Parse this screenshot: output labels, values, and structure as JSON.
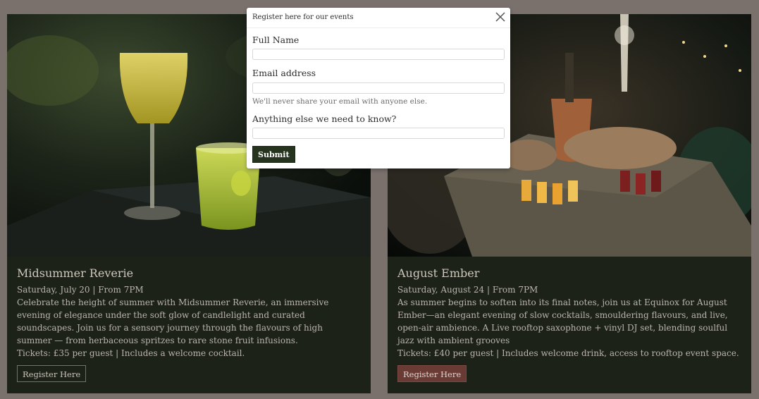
{
  "modal": {
    "title": "Register here for our events",
    "fields": [
      {
        "label": "Full Name",
        "value": ""
      },
      {
        "label": "Email address",
        "value": "",
        "help": "We'll never share your email with anyone else."
      },
      {
        "label": "Anything else we need to know?",
        "value": ""
      }
    ],
    "submit_label": "Submit"
  },
  "events": [
    {
      "title": "Midsummer Reverie",
      "date": "Saturday, July 20 | From 7PM",
      "description": "Celebrate the height of summer with Midsummer Reverie, an immersive evening of elegance under the soft glow of candlelight and curated soundscapes. Join us for a sensory journey through the flavours of high summer — from herbaceous spritzes to rare stone fruit infusions.",
      "tickets": "Tickets: £35 per guest | Includes a welcome cocktail.",
      "button_label": "Register Here"
    },
    {
      "title": "August Ember",
      "date": "Saturday, August 24 | From 7PM",
      "description": "As summer begins to soften into its final notes, join us at Equinox for August Ember—an elegant evening of slow cocktails, smouldering flavours, and live, open-air ambience. A Live rooftop saxophone + vinyl DJ set, blending soulful jazz with ambient grooves",
      "tickets": "Tickets: £40 per guest | Includes welcome drink, access to rooftop event space.",
      "button_label": "Register Here"
    }
  ],
  "colors": {
    "overlay": "#7a716d",
    "card_bg": "#1d2219",
    "submit_bg": "#25331f",
    "active_button": "#6a3b35"
  }
}
